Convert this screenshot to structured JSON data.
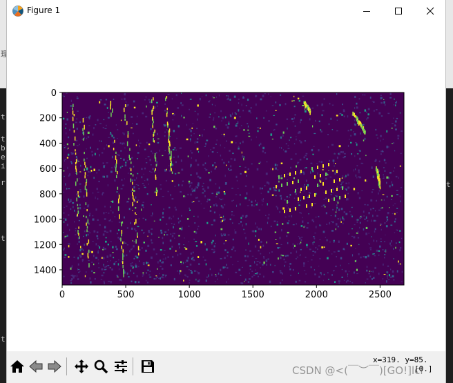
{
  "window": {
    "title": "Figure 1",
    "minimize_icon": "minimize-icon",
    "maximize_icon": "maximize-icon",
    "close_icon": "close-icon"
  },
  "toolbar": {
    "buttons": [
      {
        "name": "home-button",
        "icon": "home-icon"
      },
      {
        "name": "back-button",
        "icon": "back-arrow-icon"
      },
      {
        "name": "forward-button",
        "icon": "forward-arrow-icon"
      },
      {
        "name": "pan-button",
        "icon": "move-icon"
      },
      {
        "name": "zoom-button",
        "icon": "magnifier-icon"
      },
      {
        "name": "configure-subplots-button",
        "icon": "sliders-icon"
      },
      {
        "name": "save-button",
        "icon": "floppy-disk-icon"
      }
    ],
    "coords_line1": "x=319. y=85.",
    "coords_line2": "[0.]",
    "watermark": "CSDN @<(￣︶￣)[GO!]lcl"
  },
  "background": {
    "glyphs": [
      "t",
      "t",
      "b",
      "e",
      "i",
      "r",
      "t",
      "t",
      "t",
      "理"
    ]
  },
  "chart_data": {
    "type": "heatmap",
    "colormap": "viridis",
    "x_ticks": [
      "0",
      "500",
      "1000",
      "1500",
      "2000",
      "2500"
    ],
    "y_ticks": [
      "0",
      "200",
      "400",
      "600",
      "800",
      "1000",
      "1200",
      "1400"
    ],
    "x_range": [
      0,
      2688
    ],
    "y_range": [
      1520,
      0
    ],
    "value_range": [
      0,
      1
    ],
    "grid": false,
    "legend": "none"
  }
}
